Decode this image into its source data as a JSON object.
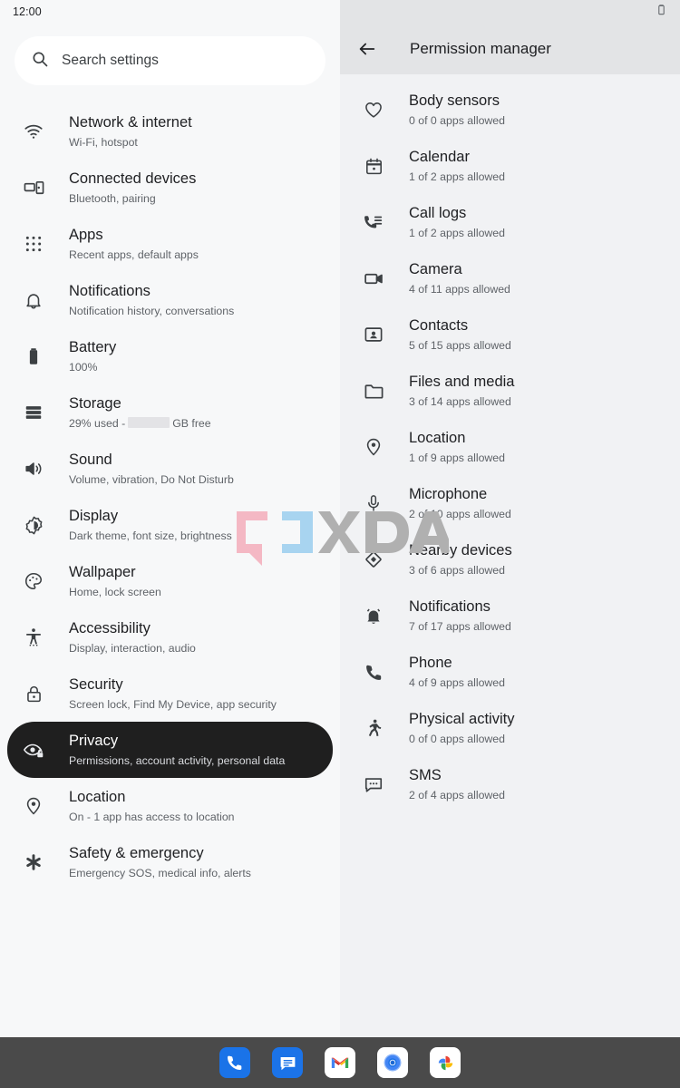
{
  "status": {
    "time": "12:00",
    "battery_icon": "battery-icon"
  },
  "search": {
    "placeholder": "Search settings",
    "icon": "search-icon"
  },
  "settings": {
    "items": [
      {
        "icon": "wifi-icon",
        "title": "Network & internet",
        "subtitle": "Wi-Fi, hotspot",
        "selected": false
      },
      {
        "icon": "connected-devices-icon",
        "title": "Connected devices",
        "subtitle": "Bluetooth, pairing",
        "selected": false
      },
      {
        "icon": "apps-grid-icon",
        "title": "Apps",
        "subtitle": "Recent apps, default apps",
        "selected": false
      },
      {
        "icon": "bell-icon",
        "title": "Notifications",
        "subtitle": "Notification history, conversations",
        "selected": false
      },
      {
        "icon": "battery-icon",
        "title": "Battery",
        "subtitle": "100%",
        "selected": false
      },
      {
        "icon": "storage-icon",
        "title": "Storage",
        "subtitle_prefix": "29% used -",
        "subtitle_suffix": "GB free",
        "redacted": true,
        "selected": false
      },
      {
        "icon": "speaker-icon",
        "title": "Sound",
        "subtitle": "Volume, vibration, Do Not Disturb",
        "selected": false
      },
      {
        "icon": "display-brightness-icon",
        "title": "Display",
        "subtitle": "Dark theme, font size, brightness",
        "selected": false
      },
      {
        "icon": "palette-icon",
        "title": "Wallpaper",
        "subtitle": "Home, lock screen",
        "selected": false
      },
      {
        "icon": "accessibility-icon",
        "title": "Accessibility",
        "subtitle": "Display, interaction, audio",
        "selected": false
      },
      {
        "icon": "lock-icon",
        "title": "Security",
        "subtitle": "Screen lock, Find My Device, app security",
        "selected": false
      },
      {
        "icon": "eye-lock-icon",
        "title": "Privacy",
        "subtitle": "Permissions, account activity, personal data",
        "selected": true
      },
      {
        "icon": "location-pin-icon",
        "title": "Location",
        "subtitle": "On - 1 app has access to location",
        "selected": false
      },
      {
        "icon": "asterisk-icon",
        "title": "Safety & emergency",
        "subtitle": "Emergency SOS, medical info, alerts",
        "selected": false
      }
    ]
  },
  "permission_manager": {
    "back_icon": "back-arrow-icon",
    "title": "Permission manager",
    "items": [
      {
        "icon": "heart-icon",
        "title": "Body sensors",
        "subtitle": "0 of 0 apps allowed"
      },
      {
        "icon": "calendar-icon",
        "title": "Calendar",
        "subtitle": "1 of 2 apps allowed"
      },
      {
        "icon": "call-logs-icon",
        "title": "Call logs",
        "subtitle": "1 of 2 apps allowed"
      },
      {
        "icon": "camera-icon",
        "title": "Camera",
        "subtitle": "4 of 11 apps allowed"
      },
      {
        "icon": "contacts-icon",
        "title": "Contacts",
        "subtitle": "5 of 15 apps allowed"
      },
      {
        "icon": "folder-icon",
        "title": "Files and media",
        "subtitle": "3 of 14 apps allowed"
      },
      {
        "icon": "location-pin-icon",
        "title": "Location",
        "subtitle": "1 of 9 apps allowed"
      },
      {
        "icon": "microphone-icon",
        "title": "Microphone",
        "subtitle": "2 of 10 apps allowed"
      },
      {
        "icon": "nearby-devices-icon",
        "title": "Nearby devices",
        "subtitle": "3 of 6 apps allowed"
      },
      {
        "icon": "notifications-bell-icon",
        "title": "Notifications",
        "subtitle": "7 of 17 apps allowed"
      },
      {
        "icon": "phone-icon",
        "title": "Phone",
        "subtitle": "4 of 9 apps allowed"
      },
      {
        "icon": "physical-activity-icon",
        "title": "Physical activity",
        "subtitle": "0 of 0 apps allowed"
      },
      {
        "icon": "sms-icon",
        "title": "SMS",
        "subtitle": "2 of 4 apps allowed"
      }
    ]
  },
  "watermark": {
    "text": "XDA",
    "bracket_left_color": "#f4b8c4",
    "bracket_right_color": "#a8d4f0",
    "letters_color": "#b0b0b0"
  },
  "taskbar": {
    "apps": [
      {
        "name": "phone-app-icon",
        "label": "Phone"
      },
      {
        "name": "messages-app-icon",
        "label": "Messages"
      },
      {
        "name": "gmail-app-icon",
        "label": "Gmail"
      },
      {
        "name": "chrome-app-icon",
        "label": "Chrome"
      },
      {
        "name": "photos-app-icon",
        "label": "Photos"
      }
    ]
  },
  "colors": {
    "left_bg": "#f7f8f9",
    "right_bg": "#f1f2f4",
    "appbar_bg": "#e3e4e6",
    "selected_pill": "#1f1f1f",
    "taskbar_bg": "#4a4a4a"
  }
}
